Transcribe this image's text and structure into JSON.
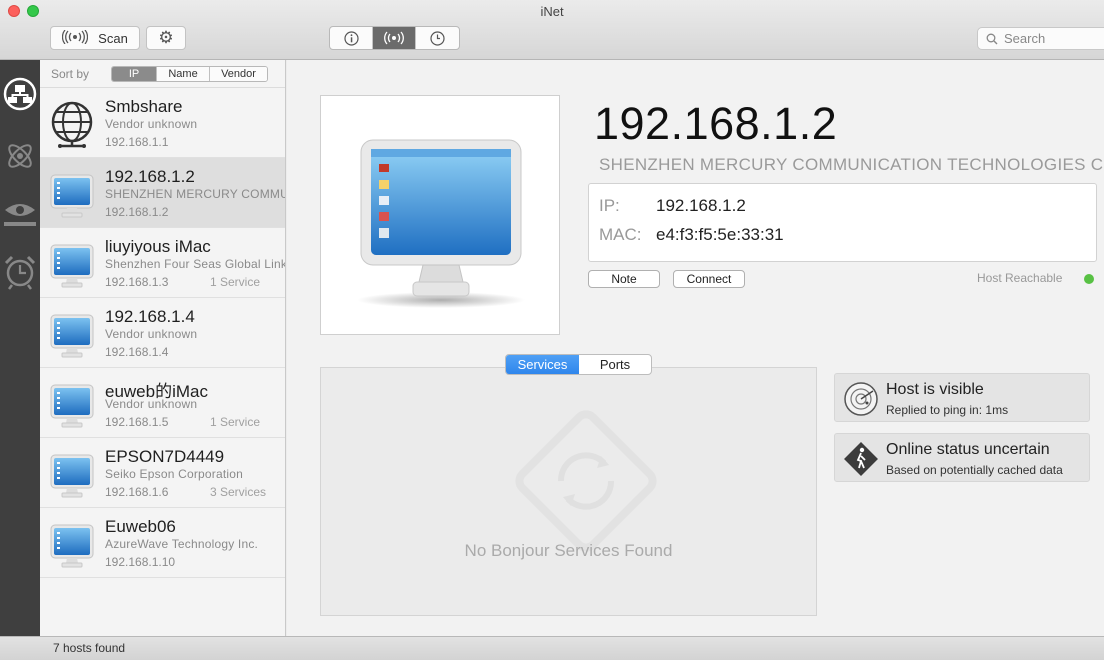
{
  "window": {
    "title": "iNet"
  },
  "toolbar": {
    "scan_label": "Scan",
    "search_placeholder": "Search",
    "view_segments": [
      "info-icon",
      "wifi-icon",
      "clock-icon"
    ]
  },
  "sidebar": {
    "sort_label": "Sort by",
    "sort_options": [
      "IP",
      "Name",
      "Vendor"
    ],
    "sort_selected": "IP",
    "rail_icons": [
      "network-icon",
      "atom-icon",
      "eye-icon",
      "alarm-clock-icon"
    ]
  },
  "hosts": [
    {
      "name": "Smbshare",
      "vendor": "Vendor unknown",
      "ip": "192.168.1.1",
      "services": "",
      "icon": "globe-icon"
    },
    {
      "name": "192.168.1.2",
      "vendor": "SHENZHEN MERCURY COMMUNICATION TECHNOLOGIES CO.,LTD.",
      "ip": "192.168.1.2",
      "services": "",
      "icon": "computer-icon",
      "selected": true
    },
    {
      "name": "liuyiyous iMac",
      "vendor": "Shenzhen Four Seas Global Link",
      "ip": "192.168.1.3",
      "services": "1 Service",
      "icon": "computer-icon"
    },
    {
      "name": "192.168.1.4",
      "vendor": "Vendor unknown",
      "ip": "192.168.1.4",
      "services": "",
      "icon": "computer-icon"
    },
    {
      "name": "euweb的iMac",
      "vendor": "Vendor unknown",
      "ip": "192.168.1.5",
      "services": "1 Service",
      "icon": "computer-icon"
    },
    {
      "name": "EPSON7D4449",
      "vendor": "Seiko Epson Corporation",
      "ip": "192.168.1.6",
      "services": "3 Services",
      "icon": "computer-icon"
    },
    {
      "name": "Euweb06",
      "vendor": "AzureWave Technology Inc.",
      "ip": "192.168.1.10",
      "services": "",
      "icon": "computer-icon"
    }
  ],
  "status": {
    "hosts_found": "7 hosts found"
  },
  "detail": {
    "ip_title": "192.168.1.2",
    "vendor": "SHENZHEN MERCURY COMMUNICATION TECHNOLOGIES CO.,LTD.",
    "ip_label": "IP:",
    "ip_value": "192.168.1.2",
    "mac_label": "MAC:",
    "mac_value": "e4:f3:f5:5e:33:31",
    "note_label": "Note",
    "connect_label": "Connect",
    "reachable_label": "Host Reachable",
    "reachable_color": "#58c144",
    "tabs": [
      "Services",
      "Ports"
    ],
    "tab_selected": "Services",
    "no_services": "No Bonjour Services Found",
    "status_cards": [
      {
        "title": "Host is visible",
        "sub": "Replied to ping in: 1ms",
        "icon": "radar-icon"
      },
      {
        "title": "Online status uncertain",
        "sub": "Based on potentially cached data",
        "icon": "pedestrian-warning-icon"
      }
    ]
  }
}
